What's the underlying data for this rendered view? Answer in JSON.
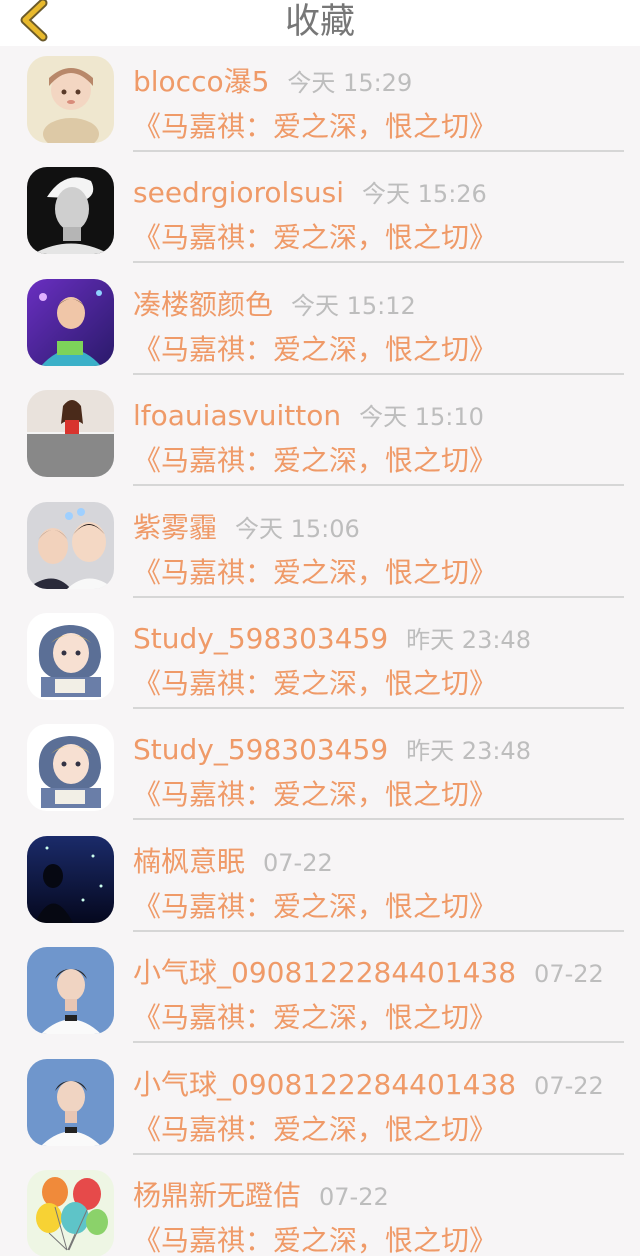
{
  "header": {
    "title": "收藏",
    "back_icon": "chevron-left-icon"
  },
  "colors": {
    "accent": "#ef9a68",
    "back_icon": "#e8b92c",
    "title": "#777777",
    "timestamp": "#bdbdbd",
    "background": "#f7f5f6"
  },
  "favorites": [
    {
      "name": "blocco瀑5",
      "time": "今天 15:29",
      "work": "《马嘉祺：爱之深，恨之切》",
      "avatar": "doll-girl"
    },
    {
      "name": "seedrgiorolsusi",
      "time": "今天 15:26",
      "work": "《马嘉祺：爱之深，恨之切》",
      "avatar": "bw-portrait"
    },
    {
      "name": "凑楼额颜色",
      "time": "今天 15:12",
      "work": "《马嘉祺：爱之深，恨之切》",
      "avatar": "stage-boy"
    },
    {
      "name": "lfoauiasvuitton",
      "time": "今天 15:10",
      "work": "《马嘉祺：爱之深，恨之切》",
      "avatar": "girl-photo"
    },
    {
      "name": "紫雾霾",
      "time": "今天 15:06",
      "work": "《马嘉祺：爱之深，恨之切》",
      "avatar": "two-boys"
    },
    {
      "name": "Study_598303459",
      "time": "昨天 23:48",
      "work": "《马嘉祺：爱之深，恨之切》",
      "avatar": "anime-girl"
    },
    {
      "name": "Study_598303459",
      "time": "昨天 23:48",
      "work": "《马嘉祺：爱之深，恨之切》",
      "avatar": "anime-girl"
    },
    {
      "name": "楠枫意眠",
      "time": "07-22",
      "work": "《马嘉祺：爱之深，恨之切》",
      "avatar": "night-silhouette"
    },
    {
      "name": "小气球_0908122284401438",
      "time": "07-22",
      "work": "《马嘉祺：爱之深，恨之切》",
      "avatar": "boy-blue"
    },
    {
      "name": "小气球_0908122284401438",
      "time": "07-22",
      "work": "《马嘉祺：爱之深，恨之切》",
      "avatar": "boy-blue"
    },
    {
      "name": "杨鼎新无蹬佶",
      "time": "07-22",
      "work": "《马嘉祺：爱之深，恨之切》",
      "avatar": "balloons"
    }
  ]
}
